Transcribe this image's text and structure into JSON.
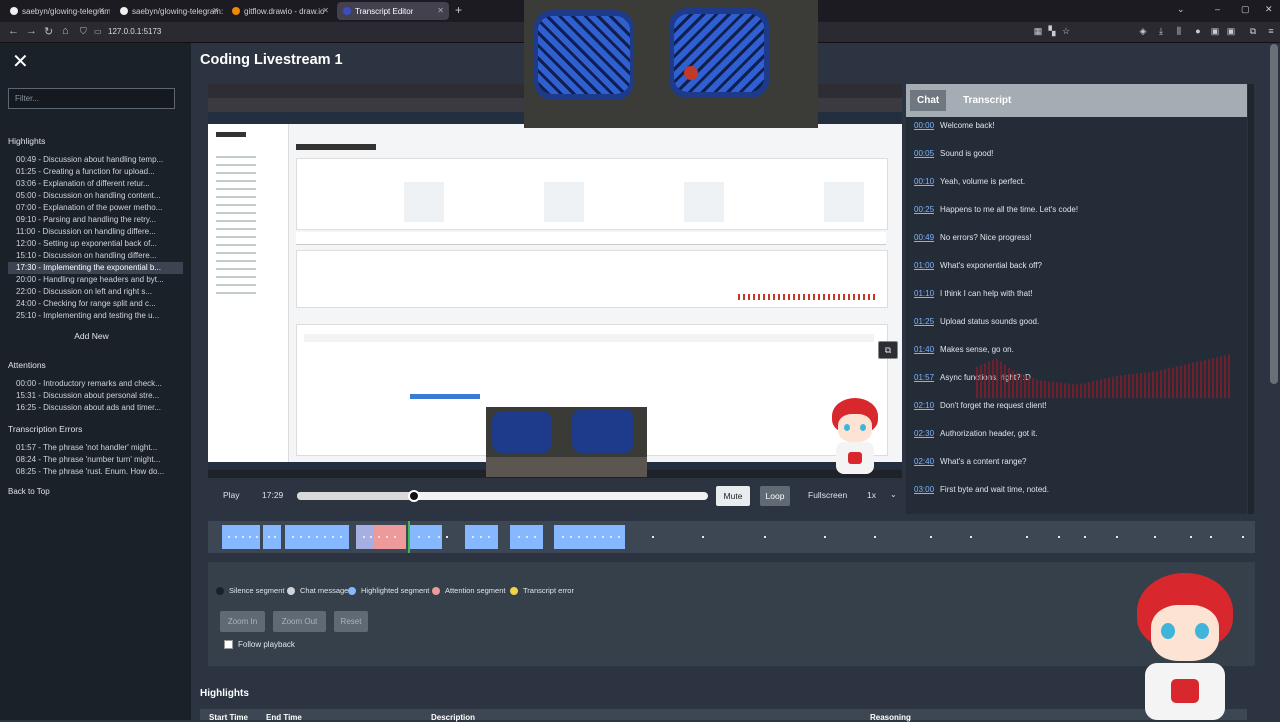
{
  "browser": {
    "tabs": [
      {
        "label": "saebyn/glowing-telegram-vide",
        "active": false,
        "color": "#f0f0f0"
      },
      {
        "label": "saebyn/glowing-telegram: A st",
        "active": false,
        "color": "#f0f0f0"
      },
      {
        "label": "gitflow.drawio - draw.io",
        "active": false,
        "color": "#f08705"
      },
      {
        "label": "Transcript Editor",
        "active": true,
        "color": "#3b4cca"
      }
    ],
    "url": "127.0.0.1:5173"
  },
  "sidebar": {
    "filter_placeholder": "Filter...",
    "highlights_title": "Highlights",
    "highlights": [
      "00:49 - Discussion about handling temp...",
      "01:25 - Creating a function for upload...",
      "03:06 - Explanation of different retur...",
      "05:00 - Discussion on handling content...",
      "07:00 - Explanation of the power metho...",
      "09:10 - Parsing and handling the retry...",
      "11:00 - Discussion on handling differe...",
      "12:00 - Setting up exponential back of...",
      "15:10 - Discussion on handling differe...",
      "17:30 - Implementing the exponential b...",
      "20:00 - Handling range headers and byt...",
      "22:00 - Discussion on left and right s...",
      "24:00 - Checking for range split and c...",
      "25:10 - Implementing and testing the u..."
    ],
    "selected_highlight": 9,
    "add_new": "Add New",
    "attentions_title": "Attentions",
    "attentions": [
      "00:00 - Introductory remarks and check...",
      "15:31 - Discussion about personal stre...",
      "16:25 - Discussion about ads and timer..."
    ],
    "errors_title": "Transcription Errors",
    "errors": [
      "01:57 - The phrase 'not handler' might...",
      "08:24 - The phrase 'number turn' might...",
      "08:25 - The phrase 'rust. Enum. How do..."
    ],
    "back_to_top": "Back to Top"
  },
  "main": {
    "title": "Coding Livestream 1"
  },
  "player": {
    "play": "Play",
    "time": "17:29",
    "progress": 0.28,
    "mute": "Mute",
    "loop": "Loop",
    "fullscreen": "Fullscreen",
    "speed": "1x"
  },
  "chat": {
    "tab_chat": "Chat",
    "tab_transcript": "Transcript",
    "messages": [
      {
        "time": "00:00",
        "text": "Welcome back!"
      },
      {
        "time": "00:05",
        "text": "Sound is good!"
      },
      {
        "time": "00:10",
        "text": "Yeah, volume is perfect."
      },
      {
        "time": "00:25",
        "text": "Happens to me all the time. Let's code!"
      },
      {
        "time": "00:49",
        "text": "No errors? Nice progress!"
      },
      {
        "time": "01:00",
        "text": "What's exponential back off?"
      },
      {
        "time": "01:10",
        "text": "I think I can help with that!"
      },
      {
        "time": "01:25",
        "text": "Upload status sounds good."
      },
      {
        "time": "01:40",
        "text": "Makes sense, go on."
      },
      {
        "time": "01:57",
        "text": "Async functions, right? :D"
      },
      {
        "time": "02:10",
        "text": "Don't forget the request client!"
      },
      {
        "time": "02:30",
        "text": "Authorization header, got it."
      },
      {
        "time": "02:40",
        "text": "What's a content range?"
      },
      {
        "time": "03:00",
        "text": "First byte and wait time, noted."
      }
    ]
  },
  "legend": [
    {
      "label": "Silence segment",
      "color": "#1b2129"
    },
    {
      "label": "Chat message",
      "color": "#d0d4d8"
    },
    {
      "label": "Highlighted segment",
      "color": "#86b8ff"
    },
    {
      "label": "Attention segment",
      "color": "#ef9a9a"
    },
    {
      "label": "Transcript error",
      "color": "#f1d34a"
    }
  ],
  "zoom": {
    "zoom_in": "Zoom In",
    "zoom_out": "Zoom Out",
    "reset": "Reset"
  },
  "follow_playback": "Follow playback",
  "highlights_section": {
    "title": "Highlights",
    "columns": [
      "Start Time",
      "End Time",
      "Description",
      "Reasoning"
    ]
  },
  "colors": {
    "accent": "#86b8ff",
    "attention": "#ef9a9a",
    "link": "#7fb3ff"
  }
}
